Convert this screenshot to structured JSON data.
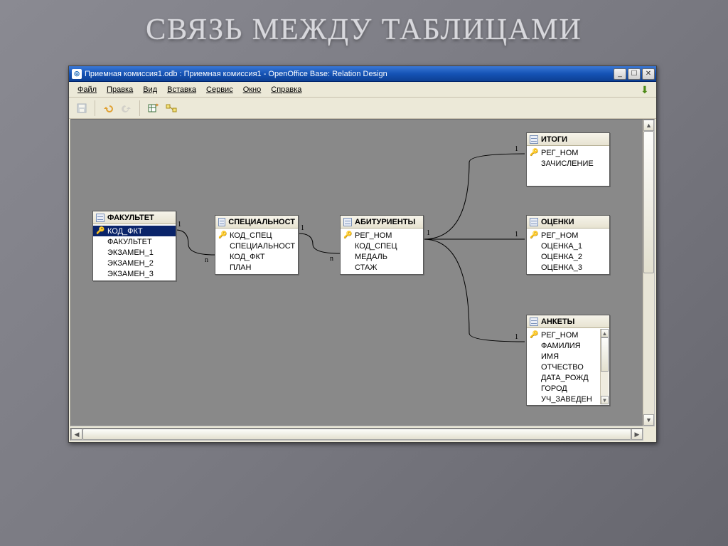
{
  "slide_title": "СВЯЗЬ МЕЖДУ ТАБЛИЦАМИ",
  "window": {
    "title": "Приемная комиссия1.odb : Приемная комиссия1 - OpenOffice Base: Relation Design"
  },
  "menu": {
    "file": "Файл",
    "edit": "Правка",
    "view": "Вид",
    "insert": "Вставка",
    "tools": "Сервис",
    "window": "Окно",
    "help": "Справка"
  },
  "tables": {
    "fakultet": {
      "title": "ФАКУЛЬТЕТ",
      "fields": [
        "КОД_ФКТ",
        "ФАКУЛЬТЕТ",
        "ЭКЗАМЕН_1",
        "ЭКЗАМЕН_2",
        "ЭКЗАМЕН_3"
      ],
      "pk_index": 0,
      "selected_index": 0
    },
    "spec": {
      "title": "СПЕЦИАЛЬНОСТ",
      "fields": [
        "КОД_СПЕЦ",
        "СПЕЦИАЛЬНОСТ",
        "КОД_ФКТ",
        "ПЛАН"
      ],
      "pk_index": 0
    },
    "abitur": {
      "title": "АБИТУРИЕНТЫ",
      "fields": [
        "РЕГ_НОМ",
        "КОД_СПЕЦ",
        "МЕДАЛЬ",
        "СТАЖ"
      ],
      "pk_index": 0
    },
    "itogi": {
      "title": "ИТОГИ",
      "fields": [
        "РЕГ_НОМ",
        "ЗАЧИСЛЕНИЕ"
      ],
      "pk_index": 0
    },
    "ocenki": {
      "title": "ОЦЕНКИ",
      "fields": [
        "РЕГ_НОМ",
        "ОЦЕНКА_1",
        "ОЦЕНКА_2",
        "ОЦЕНКА_3"
      ],
      "pk_index": 0
    },
    "ankety": {
      "title": "АНКЕТЫ",
      "fields": [
        "РЕГ_НОМ",
        "ФАМИЛИЯ",
        "ИМЯ",
        "ОТЧЕСТВО",
        "ДАТА_РОЖД",
        "ГОРОД",
        "УЧ_ЗАВЕДЕН"
      ],
      "pk_index": 0
    }
  },
  "cardinality": {
    "one": "1",
    "many": "n"
  },
  "chart_data": {
    "type": "table",
    "description": "Entity-relationship diagram of admission-committee database (OpenOffice Base Relation Design)",
    "entities": [
      {
        "name": "ФАКУЛЬТЕТ",
        "pk": "КОД_ФКТ",
        "attrs": [
          "КОД_ФКТ",
          "ФАКУЛЬТЕТ",
          "ЭКЗАМЕН_1",
          "ЭКЗАМЕН_2",
          "ЭКЗАМЕН_3"
        ]
      },
      {
        "name": "СПЕЦИАЛЬНОСТ",
        "pk": "КОД_СПЕЦ",
        "attrs": [
          "КОД_СПЕЦ",
          "СПЕЦИАЛЬНОСТ",
          "КОД_ФКТ",
          "ПЛАН"
        ]
      },
      {
        "name": "АБИТУРИЕНТЫ",
        "pk": "РЕГ_НОМ",
        "attrs": [
          "РЕГ_НОМ",
          "КОД_СПЕЦ",
          "МЕДАЛЬ",
          "СТАЖ"
        ]
      },
      {
        "name": "ИТОГИ",
        "pk": "РЕГ_НОМ",
        "attrs": [
          "РЕГ_НОМ",
          "ЗАЧИСЛЕНИЕ"
        ]
      },
      {
        "name": "ОЦЕНКИ",
        "pk": "РЕГ_НОМ",
        "attrs": [
          "РЕГ_НОМ",
          "ОЦЕНКА_1",
          "ОЦЕНКА_2",
          "ОЦЕНКА_3"
        ]
      },
      {
        "name": "АНКЕТЫ",
        "pk": "РЕГ_НОМ",
        "attrs": [
          "РЕГ_НОМ",
          "ФАМИЛИЯ",
          "ИМЯ",
          "ОТЧЕСТВО",
          "ДАТА_РОЖД",
          "ГОРОД",
          "УЧ_ЗАВЕДЕН"
        ]
      }
    ],
    "relations": [
      {
        "from": "ФАКУЛЬТЕТ.КОД_ФКТ",
        "to": "СПЕЦИАЛЬНОСТ.КОД_ФКТ",
        "cardinality": "1:n"
      },
      {
        "from": "СПЕЦИАЛЬНОСТ.КОД_СПЕЦ",
        "to": "АБИТУРИЕНТЫ.КОД_СПЕЦ",
        "cardinality": "1:n"
      },
      {
        "from": "АБИТУРИЕНТЫ.РЕГ_НОМ",
        "to": "ИТОГИ.РЕГ_НОМ",
        "cardinality": "1:1"
      },
      {
        "from": "АБИТУРИЕНТЫ.РЕГ_НОМ",
        "to": "ОЦЕНКИ.РЕГ_НОМ",
        "cardinality": "1:1"
      },
      {
        "from": "АБИТУРИЕНТЫ.РЕГ_НОМ",
        "to": "АНКЕТЫ.РЕГ_НОМ",
        "cardinality": "1:1"
      }
    ]
  }
}
